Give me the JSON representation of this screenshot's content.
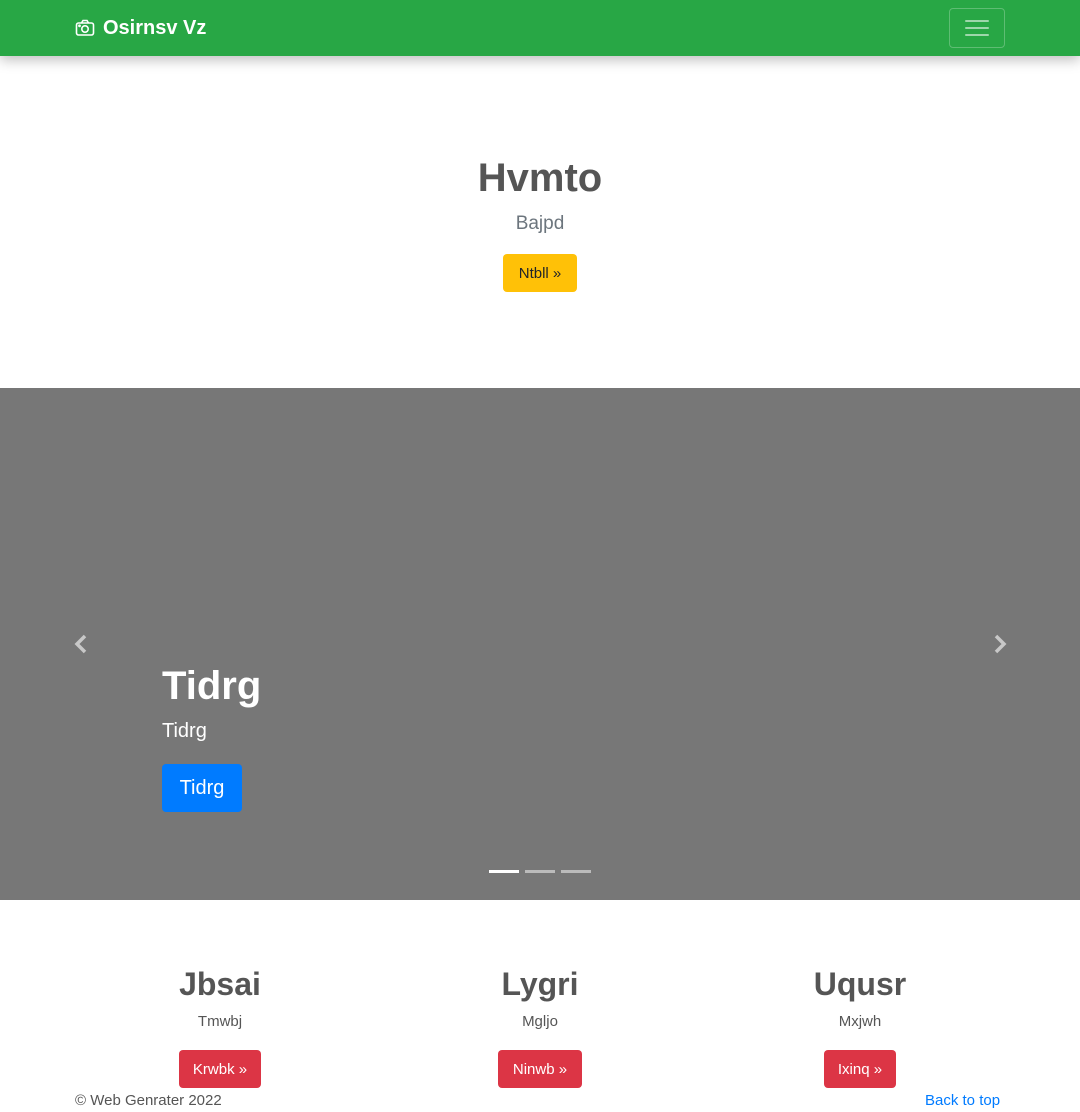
{
  "navbar": {
    "brand": "Osirnsv Vz",
    "brand_icon": "camera-icon",
    "toggler_icon": "hamburger-icon",
    "color": "#28a745"
  },
  "hero": {
    "title": "Hvmto",
    "subtitle": "Bajpd",
    "button": "Ntbll »",
    "button_color": "#ffc107"
  },
  "carousel": {
    "background": "#777777",
    "prev_icon": "chevron-left-icon",
    "next_icon": "chevron-right-icon",
    "caption_title": "Tidrg",
    "caption_text": "Tidrg",
    "caption_button": "Tidrg",
    "button_color": "#007bff",
    "indicator_count": 3,
    "active_indicator": 0
  },
  "features": [
    {
      "title": "Jbsai",
      "text": "Tmwbj",
      "button": "Krwbk »"
    },
    {
      "title": "Lygri",
      "text": "Mgljo",
      "button": "Ninwb »"
    },
    {
      "title": "Uqusr",
      "text": "Mxjwh",
      "button": "Ixinq »"
    }
  ],
  "feature_button_color": "#dc3545",
  "footer": {
    "copyright": "© Web Genrater 2022",
    "back_to_top": "Back to top"
  }
}
